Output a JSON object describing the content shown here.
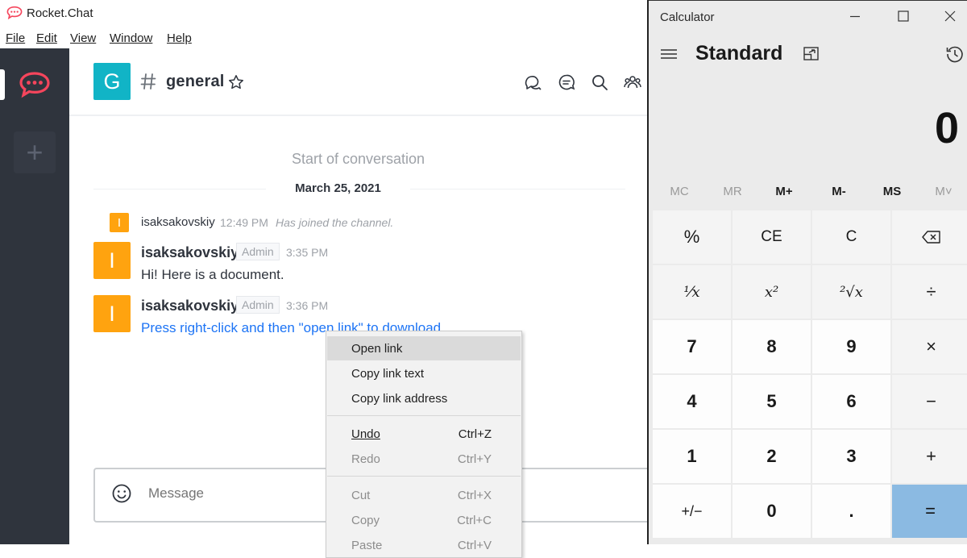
{
  "rocketchat": {
    "window_title": "Rocket.Chat",
    "menu": [
      {
        "label": "File"
      },
      {
        "label": "Edit"
      },
      {
        "label": "View"
      },
      {
        "label": "Window"
      },
      {
        "label": "Help"
      }
    ],
    "sidebar": {
      "add_label": "+"
    },
    "room": {
      "avatar_letter": "G",
      "name": "general"
    },
    "conversation": {
      "start_text": "Start of conversation",
      "date": "March 25, 2021",
      "system_message": {
        "avatar_letter": "I",
        "user": "isaksakovskiy",
        "time": "12:49 PM",
        "text": "Has joined the channel."
      },
      "messages": [
        {
          "avatar_letter": "I",
          "user": "isaksakovskiy",
          "role": "Admin",
          "time": "3:35 PM",
          "text": "Hi! Here is a document."
        },
        {
          "avatar_letter": "I",
          "user": "isaksakovskiy",
          "role": "Admin",
          "time": "3:36 PM",
          "text": "Press right-click and then \"open link\" to download"
        }
      ]
    },
    "composer": {
      "placeholder": "Message"
    },
    "colors": {
      "sidebar": "#2f343d",
      "brand_red": "#f5455c",
      "link": "#1d74f5",
      "user_avatar": "#ffa30f",
      "room_avatar": "#11b4c6"
    }
  },
  "context_menu": {
    "items": [
      {
        "label": "Open link",
        "accel": ""
      },
      {
        "label": "Copy link text",
        "accel": ""
      },
      {
        "label": "Copy link address",
        "accel": ""
      },
      {
        "label": "Undo",
        "accel": "Ctrl+Z"
      },
      {
        "label": "Redo",
        "accel": "Ctrl+Y"
      },
      {
        "label": "Cut",
        "accel": "Ctrl+X"
      },
      {
        "label": "Copy",
        "accel": "Ctrl+C"
      },
      {
        "label": "Paste",
        "accel": "Ctrl+V"
      }
    ]
  },
  "calculator": {
    "window_title": "Calculator",
    "mode": "Standard",
    "display": "0",
    "memory": [
      "MC",
      "MR",
      "M+",
      "M-",
      "MS",
      "M˅"
    ],
    "keys": [
      "%",
      "CE",
      "C",
      "⌫",
      "¹⁄x",
      "x²",
      "²√x",
      "÷",
      "7",
      "8",
      "9",
      "×",
      "4",
      "5",
      "6",
      "−",
      "1",
      "2",
      "3",
      "+",
      "+/−",
      "0",
      ".",
      "="
    ],
    "colors": {
      "equals": "#8bbae2",
      "background": "#ebebeb"
    }
  }
}
